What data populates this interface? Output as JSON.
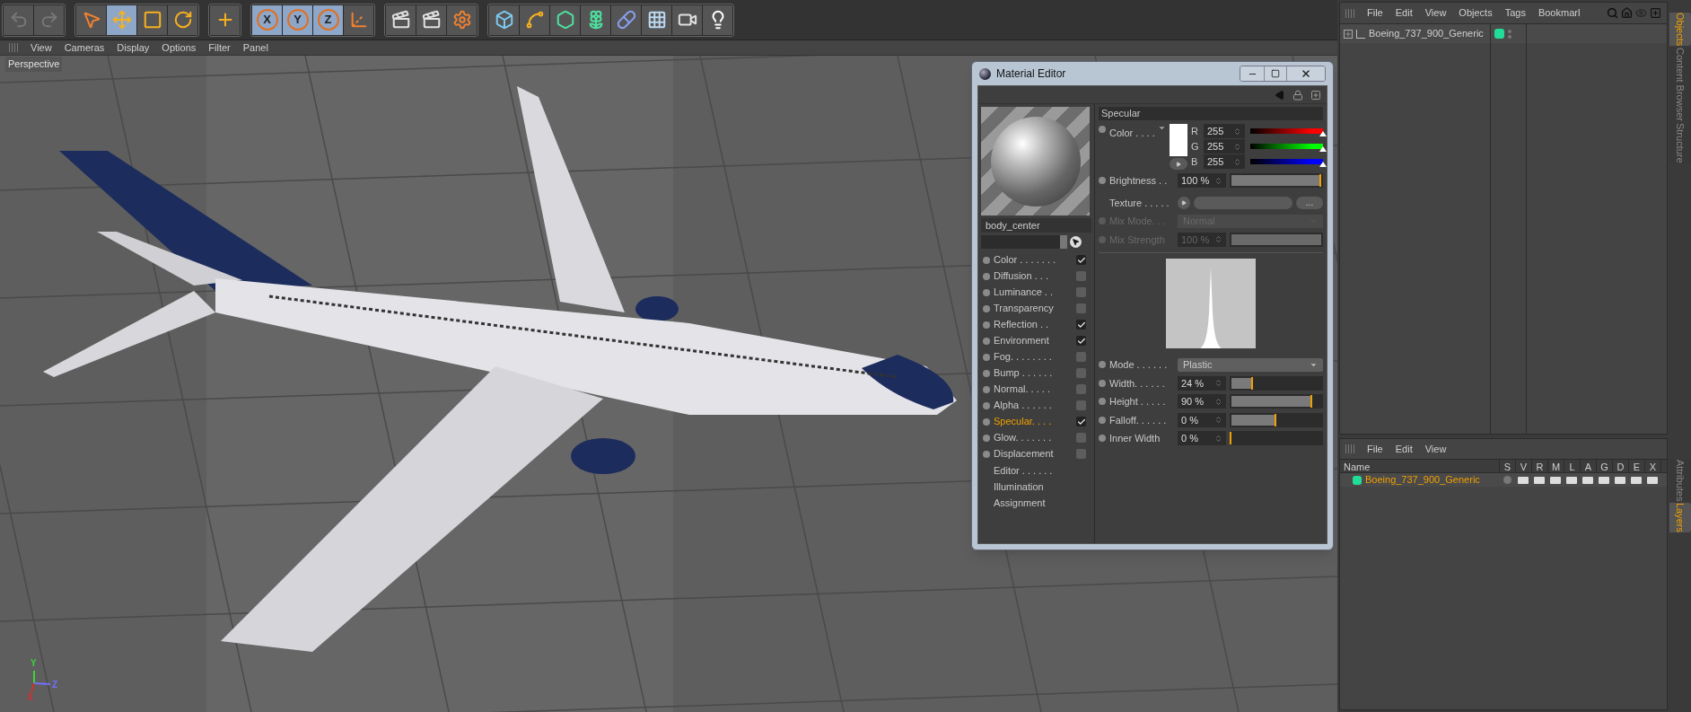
{
  "toolbar": {
    "groups": [
      {
        "tools": [
          {
            "kind": "undo",
            "selected": false
          },
          {
            "kind": "redo",
            "selected": false
          }
        ]
      },
      {
        "tools": [
          {
            "kind": "select",
            "selected": false
          },
          {
            "kind": "move",
            "selected": true
          },
          {
            "kind": "scale",
            "selected": false
          },
          {
            "kind": "rotate",
            "selected": false
          }
        ]
      },
      {
        "tools": [
          {
            "kind": "add",
            "selected": false
          }
        ]
      },
      {
        "tools": [
          {
            "kind": "axis",
            "label": "X",
            "selected": true
          },
          {
            "kind": "axis",
            "label": "Y",
            "selected": true
          },
          {
            "kind": "axis",
            "label": "Z",
            "selected": true
          },
          {
            "kind": "coords",
            "selected": false
          }
        ]
      },
      {
        "tools": [
          {
            "kind": "render_view",
            "selected": false
          },
          {
            "kind": "render_pic",
            "selected": false
          },
          {
            "kind": "render_settings",
            "selected": false
          }
        ]
      },
      {
        "tools": [
          {
            "kind": "cube",
            "selected": false
          },
          {
            "kind": "spline",
            "selected": false
          },
          {
            "kind": "subdivision",
            "selected": false
          },
          {
            "kind": "cloner",
            "selected": false
          },
          {
            "kind": "deformer",
            "selected": false
          },
          {
            "kind": "floor",
            "selected": false
          },
          {
            "kind": "camera",
            "selected": false
          },
          {
            "kind": "light",
            "selected": false
          }
        ]
      }
    ]
  },
  "viewport": {
    "menu": [
      "View",
      "Cameras",
      "Display",
      "Options",
      "Filter",
      "Panel"
    ],
    "camera_label": "Perspective",
    "axes": [
      {
        "label": "Y",
        "color": "#3bd43b"
      },
      {
        "label": "Z",
        "color": "#7070ff"
      },
      {
        "label": "X",
        "color": "#d43030"
      }
    ]
  },
  "material_editor": {
    "title": "Material Editor",
    "material_name": "body_center",
    "channels": [
      {
        "kind": "channel",
        "label": "Color . . . . . . .",
        "checked": true,
        "selected": false
      },
      {
        "kind": "channel",
        "label": "Diffusion . . .",
        "checked": false,
        "selected": false
      },
      {
        "kind": "channel",
        "label": "Luminance . .",
        "checked": false,
        "selected": false
      },
      {
        "kind": "channel",
        "label": "Transparency",
        "checked": false,
        "selected": false
      },
      {
        "kind": "channel",
        "label": "Reflection . .",
        "checked": true,
        "selected": false
      },
      {
        "kind": "channel",
        "label": "Environment",
        "checked": true,
        "selected": false
      },
      {
        "kind": "channel",
        "label": "Fog. . . . . . . .",
        "checked": false,
        "selected": false
      },
      {
        "kind": "channel",
        "label": "Bump . . . . . .",
        "checked": false,
        "selected": false
      },
      {
        "kind": "channel",
        "label": "Normal. . . . .",
        "checked": false,
        "selected": false
      },
      {
        "kind": "channel",
        "label": "Alpha . . . . . .",
        "checked": false,
        "selected": false
      },
      {
        "kind": "channel",
        "label": "Specular. . . .",
        "checked": true,
        "selected": true
      },
      {
        "kind": "channel",
        "label": "Glow. . . . . . .",
        "checked": false,
        "selected": false
      },
      {
        "kind": "channel",
        "label": "Displacement",
        "checked": false,
        "selected": false
      },
      {
        "kind": "page",
        "label": "Editor . . . . . ."
      },
      {
        "kind": "page",
        "label": "Illumination"
      },
      {
        "kind": "page",
        "label": "Assignment"
      }
    ],
    "section_title": "Specular",
    "color": {
      "label": "Color . . . .",
      "components": [
        {
          "label": "R",
          "value": "255",
          "level": 1,
          "color": "#ff0000"
        },
        {
          "label": "G",
          "value": "255",
          "level": 1,
          "color": "#00ff00"
        },
        {
          "label": "B",
          "value": "255",
          "level": 1,
          "color": "#0000ff"
        }
      ]
    },
    "brightness": {
      "label": "Brightness . .",
      "value": "100 %",
      "level": 1
    },
    "texture": {
      "label": "Texture . . . . .",
      "button": "..."
    },
    "mix_mode": {
      "label": "Mix Mode. . .",
      "value": "Normal",
      "disabled": true
    },
    "mix_strength": {
      "label": "Mix Strength",
      "value": "100 %",
      "level": 1,
      "disabled": true
    },
    "mode": {
      "label": "Mode . . . . . .",
      "value": "Plastic"
    },
    "params": [
      {
        "label": "Width. . . . . .",
        "value": "24 %",
        "level": 0.24
      },
      {
        "label": "Height . . . . .",
        "value": "90 %",
        "level": 0.9
      },
      {
        "label": "Falloff. . . . . .",
        "value": "0 %",
        "level": 0.5
      },
      {
        "label": "Inner Width",
        "value": "0 %",
        "level": 0
      }
    ]
  },
  "objects_panel": {
    "menu": [
      "File",
      "Edit",
      "View",
      "Objects",
      "Tags",
      "Bookmarl"
    ],
    "objects": [
      {
        "name": "Boeing_737_900_Generic"
      }
    ]
  },
  "side_tabs_top": [
    {
      "label": "Objects",
      "selected": true
    },
    {
      "label": "Content Browser",
      "selected": false
    },
    {
      "label": "Structure",
      "selected": false
    }
  ],
  "layers_panel": {
    "menu": [
      "File",
      "Edit",
      "View"
    ],
    "columns": [
      "Name",
      "S",
      "V",
      "R",
      "M",
      "L",
      "A",
      "G",
      "D",
      "E",
      "X"
    ],
    "rows": [
      {
        "name": "Boeing_737_900_Generic"
      }
    ]
  },
  "side_tabs_bottom": [
    {
      "label": "Attributes",
      "selected": false
    },
    {
      "label": "Layers",
      "selected": true
    }
  ]
}
